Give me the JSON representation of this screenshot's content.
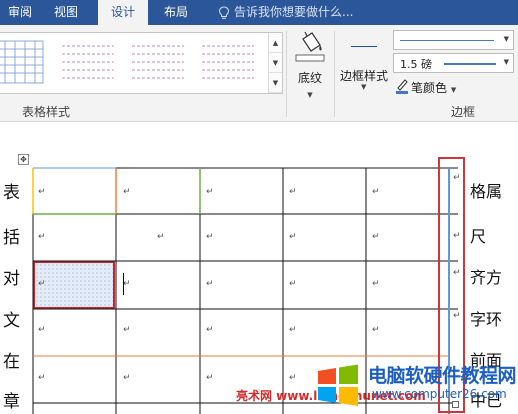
{
  "ribbon_tabs": [
    {
      "label": "审阅"
    },
    {
      "label": "视图"
    },
    {
      "label": "设计",
      "active": true
    },
    {
      "label": "布局"
    }
  ],
  "tell_me": {
    "placeholder": "告诉我你想要做什么...",
    "icon": "lightbulb-icon"
  },
  "table_styles": {
    "group_label": "表格样式",
    "thumbnail_count": 5
  },
  "shading": {
    "label": "底纹",
    "icon": "paint-bucket-icon"
  },
  "borders": {
    "group_label": "边框",
    "border_styles_label": "边框样式",
    "line_weight": "1.5 磅",
    "pen_color_label": "笔颜色",
    "pen_color": "#4472c4"
  },
  "document": {
    "left_chars": [
      "表",
      "括",
      "对",
      "文",
      "在",
      "章"
    ],
    "right_texts": [
      "格属",
      "尺",
      "齐方",
      "字环",
      "前面",
      "中已"
    ],
    "paragraph_mark": "↵",
    "table_rows": 5,
    "table_columns": 6,
    "selected_cell": {
      "row": 3,
      "column": 1
    },
    "colors": {
      "selection_border": "#c8262e",
      "annotation_box": "#d2343b",
      "orange_border": "#ed7d31",
      "green_border": "#70ad47",
      "yellow_border": "#ffc000",
      "blue_border": "#5b9bd5"
    }
  },
  "watermark": {
    "brand": "电脑软硬件教程网",
    "url": "www.computer26.com",
    "site_text": "亮术网 www.liangshunet.com"
  }
}
